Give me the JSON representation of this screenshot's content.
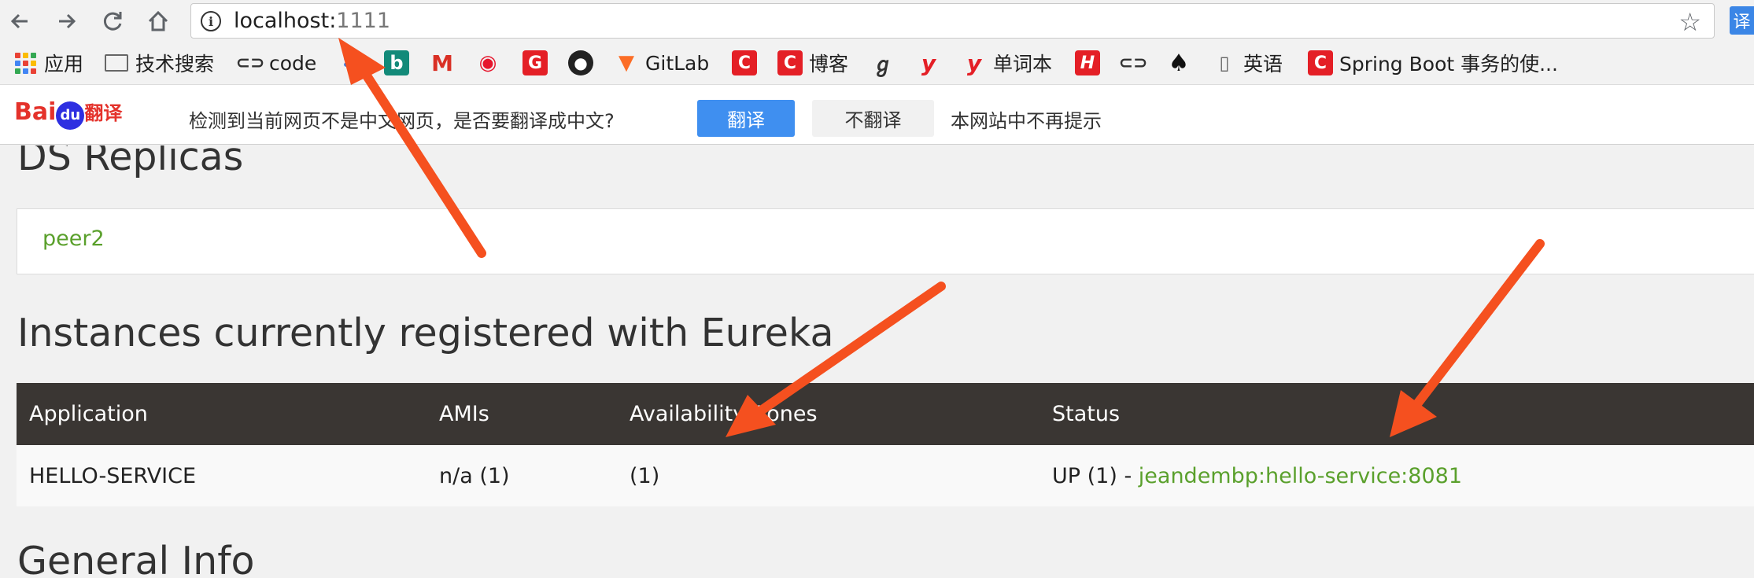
{
  "browser": {
    "url_host": "localhost:",
    "url_port": "1111",
    "translate_ext_label": "译"
  },
  "bookmarks": {
    "apps": "应用",
    "tech_search": "技术搜索",
    "code": "code",
    "gitlab": "GitLab",
    "blog": "博客",
    "vocab": "单词本",
    "english": "英语",
    "spring_boot": "Spring Boot 事务的使..."
  },
  "translate_bar": {
    "logo_bai": "Bai",
    "logo_du": "du",
    "logo_fy": "翻译",
    "prompt": "检测到当前网页不是中文网页，是否要翻译成中文?",
    "translate_button": "翻译",
    "no_translate_button": "不翻译",
    "never_prompt": "本网站中不再提示"
  },
  "page": {
    "replicas_title": "DS Replicas",
    "replica_link": "peer2",
    "instances_title": "Instances currently registered with Eureka",
    "table": {
      "headers": [
        "Application",
        "AMIs",
        "Availability Zones",
        "Status"
      ],
      "rows": [
        {
          "application": "HELLO-SERVICE",
          "amis": "n/a (1)",
          "zones": "(1)",
          "status_prefix": "UP (1) - ",
          "status_link": "jeandembp:hello-service:8081"
        }
      ]
    },
    "general_info_title": "General Info"
  },
  "colors": {
    "link_green": "#5aa02c",
    "table_header": "#3a3633",
    "arrow": "#f5501f",
    "baidu_red": "#e4322b",
    "baidu_blue": "#2e2fe1",
    "translate_blue": "#3f8ff0"
  },
  "icons": [
    "back-arrow-icon",
    "forward-arrow-icon",
    "reload-icon",
    "home-icon",
    "info-icon",
    "star-icon",
    "apps-grid-icon",
    "folder-icon",
    "link-icon",
    "github-icon",
    "gitlab-icon",
    "weibo-icon",
    "gmail-icon",
    "bing-icon",
    "spade-icon",
    "page-icon"
  ]
}
